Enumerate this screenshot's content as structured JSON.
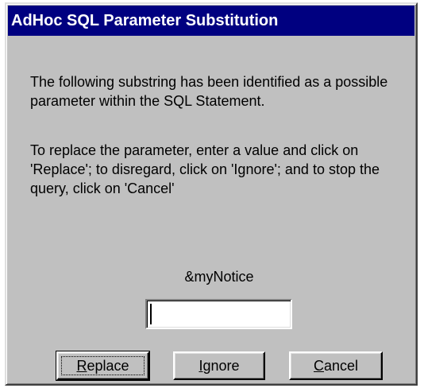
{
  "dialog": {
    "title": "AdHoc SQL Parameter Substitution",
    "message_1": "The following substring has been identified as a possible parameter within the SQL Statement.",
    "message_2": "To replace the parameter, enter a value and click on 'Replace'; to disregard, click on 'Ignore'; and to stop the query, click on 'Cancel'",
    "parameter_name": "&myNotice",
    "input": {
      "value": "",
      "placeholder": ""
    },
    "buttons": {
      "replace": {
        "mnemonic": "R",
        "rest": "eplace"
      },
      "ignore": {
        "mnemonic": "I",
        "rest": "gnore"
      },
      "cancel": {
        "mnemonic": "C",
        "rest": "ancel"
      }
    }
  },
  "colors": {
    "titlebar_bg": "#000080",
    "titlebar_fg": "#ffffff",
    "dialog_bg": "#c0c0c0"
  }
}
